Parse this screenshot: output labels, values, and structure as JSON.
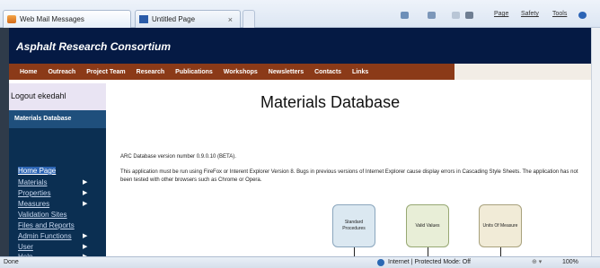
{
  "browser": {
    "tabs": [
      {
        "label": "Web Mail Messages"
      },
      {
        "label": "Untitled Page"
      }
    ],
    "close_glyph": "×",
    "commands": {
      "page": "Page",
      "safety": "Safety",
      "tools": "Tools"
    },
    "status": {
      "left": "Done",
      "zone": "Internet | Protected Mode: Off",
      "zoom": "100%"
    }
  },
  "site": {
    "title": "Asphalt Research Consortium"
  },
  "nav": {
    "items": [
      "Home",
      "Outreach",
      "Project Team",
      "Research",
      "Publications",
      "Workshops",
      "Newsletters",
      "Contacts",
      "Links"
    ]
  },
  "sidebar": {
    "logout": "Logout ekedahl",
    "heading": "Materials Database",
    "links": [
      {
        "label": "Home Page",
        "submenu": false
      },
      {
        "label": "Materials",
        "submenu": true
      },
      {
        "label": "Properties",
        "submenu": true
      },
      {
        "label": "Measures",
        "submenu": true
      },
      {
        "label": "Validation Sites",
        "submenu": false
      },
      {
        "label": "Files and Reports",
        "submenu": false
      },
      {
        "label": "Admin Functions",
        "submenu": true
      },
      {
        "label": "User",
        "submenu": true
      },
      {
        "label": "Help",
        "submenu": true
      }
    ]
  },
  "main": {
    "title": "Materials Database",
    "version": "ARC Database version number 0.9.0.10 (BETA).",
    "notice": "This application must be run using FireFox or Interent Explorer Version 8. Bugs in previous versions of Internet Explorer cause display errors in Cascading Style Sheets. The application has not been tested with other browsers such as Chrome or Opera.",
    "boxes": [
      "Standard Procedures",
      "Valid Values",
      "Units Of Measure"
    ]
  },
  "colors": {
    "banner": "#051a44",
    "nav": "#8b3a18",
    "sidebar": "#0b2f52"
  }
}
